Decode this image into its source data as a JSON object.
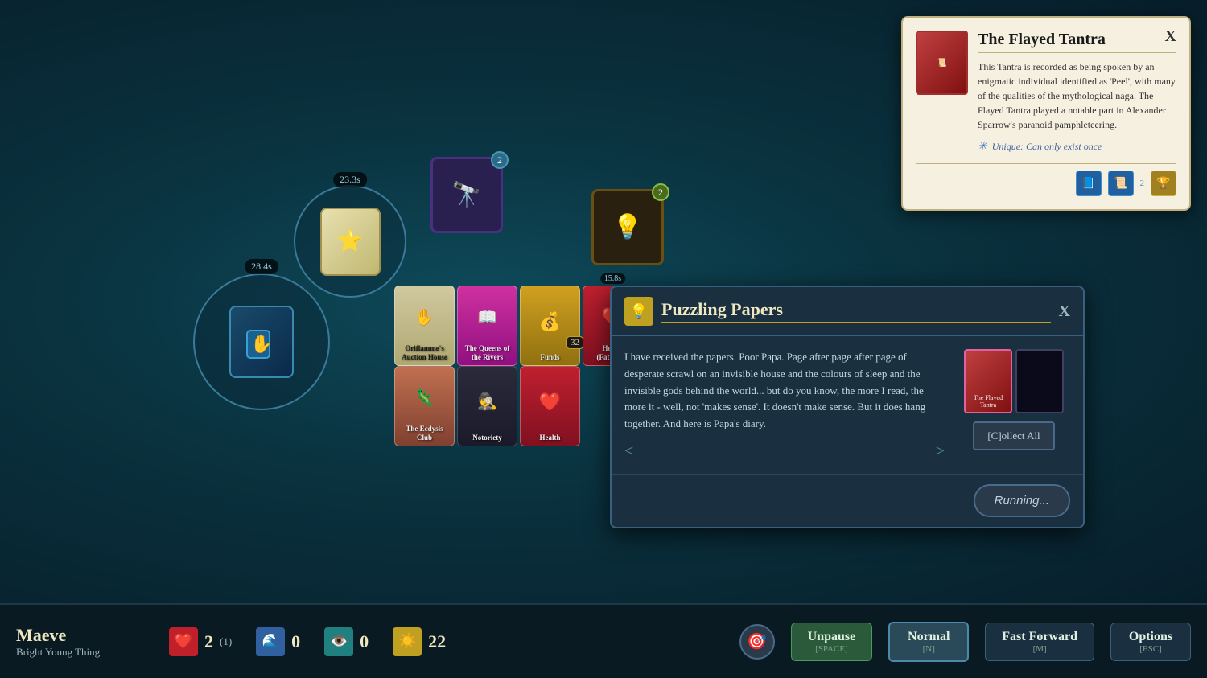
{
  "game": {
    "board_bg": "#0d3340"
  },
  "tooltip": {
    "title": "The Flayed Tantra",
    "description": "This Tantra is recorded as being spoken by an enigmatic individual identified as 'Peel', with many of the qualities of the mythological naga. The Flayed Tantra played a notable part in Alexander Sparrow's paranoid pamphleteering.",
    "unique_label": "Unique: Can only exist once",
    "close": "X"
  },
  "dialog": {
    "title": "Puzzling Papers",
    "text": "I have received the papers. Poor Papa. Page after page after page of desperate scrawl on an invisible house and the colours of sleep and the invisible gods behind the world... but do you know, the more I read, the more it - well, not 'makes sense'. It doesn't make sense. But it does hang together. And here is Papa's diary.",
    "nav_prev": "<",
    "nav_next": ">",
    "card_label": "The Flayed Tantra",
    "collect_btn": "[C]ollect All",
    "running_btn": "Running...",
    "close": "X"
  },
  "board": {
    "card1_timer": "23.3s",
    "card2_timer": "28.4s",
    "card3_count": "2",
    "card4_count": "2",
    "hand_cards": [
      {
        "label": "Oriflamme's Auction House",
        "color": "#c0c0c0",
        "bg": "#e0e0d0"
      },
      {
        "label": "The Queens of the Rivers",
        "color": "#f0f0f0",
        "bg": "#c020a0"
      },
      {
        "label": "Funds",
        "color": "#f0f0f0",
        "bg": "#c0a020"
      },
      {
        "label": "Health (Fatigued)",
        "color": "#f0f0f0",
        "bg": "#c02030",
        "timer": "15.8s",
        "count": "32"
      },
      {
        "label": "The Ecdysis Club",
        "color": "#f0f0f0",
        "bg": "#c06040"
      },
      {
        "label": "Notoriety",
        "color": "#f0f0f0",
        "bg": "#1a1a2a"
      },
      {
        "label": "Health",
        "color": "#f0f0f0",
        "bg": "#c02030"
      }
    ]
  },
  "bottombar": {
    "player_name": "Maeve",
    "player_title": "Bright Young Thing",
    "health_value": "2",
    "health_sub": "(1)",
    "passion_value": "0",
    "reason_value": "0",
    "funds_value": "22",
    "btn_unpause": "Unpause",
    "btn_unpause_key": "[SPACE]",
    "btn_normal": "Normal",
    "btn_normal_key": "[N]",
    "btn_fastforward": "Fast Forward",
    "btn_fastforward_key": "[M]",
    "btn_options": "Options",
    "btn_options_key": "[ESC]"
  }
}
